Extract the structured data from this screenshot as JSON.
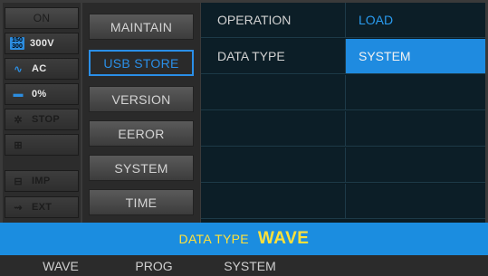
{
  "status": {
    "output": {
      "label": "ON",
      "active": false
    },
    "items": [
      {
        "icon": "range-icon",
        "glyph": "1:50",
        "label": "300V",
        "active": true
      },
      {
        "icon": "ac-wave-icon",
        "glyph": "∿",
        "label": "AC",
        "active": true
      },
      {
        "icon": "bar-level-icon",
        "glyph": "▬",
        "label": "0%",
        "active": true
      },
      {
        "icon": "stop-icon",
        "glyph": "✲",
        "label": "STOP",
        "active": false
      },
      {
        "icon": "mode-icon",
        "glyph": "⊞",
        "label": "",
        "active": false
      },
      {
        "icon": "impedance-icon",
        "glyph": "⊟",
        "label": "IMP",
        "active": false
      },
      {
        "icon": "external-icon",
        "glyph": "⇝",
        "label": "EXT",
        "active": false
      }
    ]
  },
  "menu": {
    "items": [
      {
        "label": "MAINTAIN",
        "selected": false
      },
      {
        "label": "USB STORE",
        "selected": true
      },
      {
        "label": "VERSION",
        "selected": false
      },
      {
        "label": "EEROR",
        "selected": false
      },
      {
        "label": "SYSTEM",
        "selected": false
      },
      {
        "label": "TIME",
        "selected": false
      }
    ]
  },
  "table": {
    "rows": [
      {
        "label": "OPERATION",
        "value": "LOAD"
      },
      {
        "label": "DATA TYPE",
        "value": "SYSTEM"
      },
      {
        "label": "",
        "value": ""
      },
      {
        "label": "",
        "value": ""
      },
      {
        "label": "",
        "value": ""
      },
      {
        "label": "",
        "value": ""
      }
    ]
  },
  "info_bar": {
    "label": "DATA TYPE",
    "value": "WAVE"
  },
  "softkeys": [
    {
      "label": "WAVE"
    },
    {
      "label": "PROG"
    },
    {
      "label": "SYSTEM"
    }
  ],
  "colors": {
    "accent_blue": "#1f8be0",
    "highlight_yellow": "#ffe13a"
  }
}
